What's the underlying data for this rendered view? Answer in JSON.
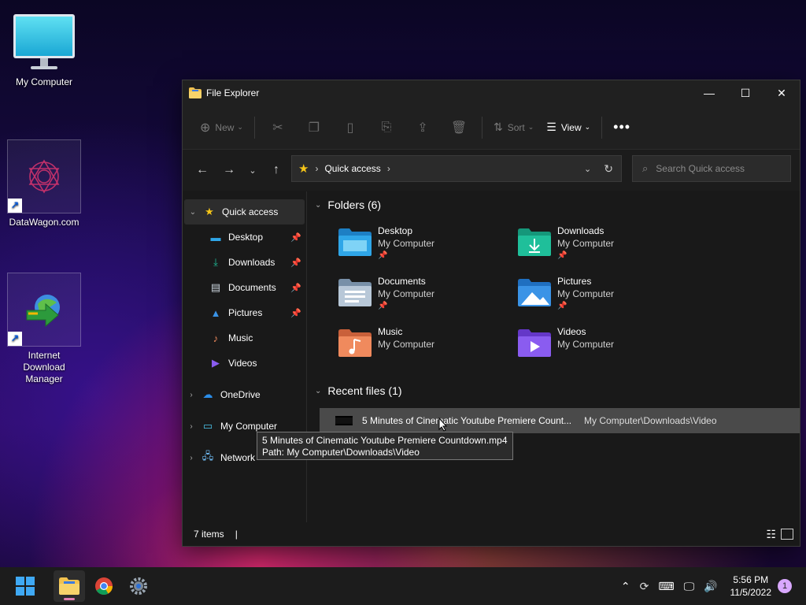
{
  "desktop": {
    "icons": [
      {
        "label": "My Computer"
      },
      {
        "label": "DataWagon.com"
      },
      {
        "label": "Internet Download Manager"
      }
    ]
  },
  "window": {
    "title": "File Explorer",
    "toolbar": {
      "new_label": "New",
      "sort_label": "Sort",
      "view_label": "View"
    },
    "address": {
      "path": "Quick access"
    },
    "search": {
      "placeholder": "Search Quick access"
    },
    "sidebar": {
      "quick_access": "Quick access",
      "items": [
        {
          "label": "Desktop",
          "icon": "desktop-icon",
          "pinned": true
        },
        {
          "label": "Downloads",
          "icon": "download-icon",
          "pinned": true
        },
        {
          "label": "Documents",
          "icon": "document-icon",
          "pinned": true
        },
        {
          "label": "Pictures",
          "icon": "picture-icon",
          "pinned": true
        },
        {
          "label": "Music",
          "icon": "music-icon",
          "pinned": false
        },
        {
          "label": "Videos",
          "icon": "video-icon",
          "pinned": false
        }
      ],
      "roots": [
        {
          "label": "OneDrive"
        },
        {
          "label": "My Computer"
        },
        {
          "label": "Network"
        }
      ]
    },
    "folders": {
      "heading": "Folders (6)",
      "items": [
        {
          "name": "Desktop",
          "location": "My Computer",
          "color": "#2fa6e8",
          "pinned": true
        },
        {
          "name": "Downloads",
          "location": "My Computer",
          "color": "#1fbf9a",
          "pinned": true
        },
        {
          "name": "Documents",
          "location": "My Computer",
          "color": "#9db3c9",
          "pinned": true
        },
        {
          "name": "Pictures",
          "location": "My Computer",
          "color": "#3a93e6",
          "pinned": true
        },
        {
          "name": "Music",
          "location": "My Computer",
          "color": "#f08a5d",
          "pinned": false
        },
        {
          "name": "Videos",
          "location": "My Computer",
          "color": "#8a5cf0",
          "pinned": false
        }
      ]
    },
    "recent": {
      "heading": "Recent files (1)",
      "files": [
        {
          "name": "5 Minutes of Cinematic Youtube Premiere Count...",
          "path": "My Computer\\Downloads\\Video"
        }
      ]
    },
    "tooltip": {
      "line1": "5 Minutes of Cinematic Youtube Premiere Countdown.mp4",
      "line2": "Path: My Computer\\Downloads\\Video"
    },
    "status": {
      "items": "7 items"
    }
  },
  "taskbar": {
    "time": "5:56 PM",
    "date": "11/5/2022",
    "notifications": "1"
  }
}
